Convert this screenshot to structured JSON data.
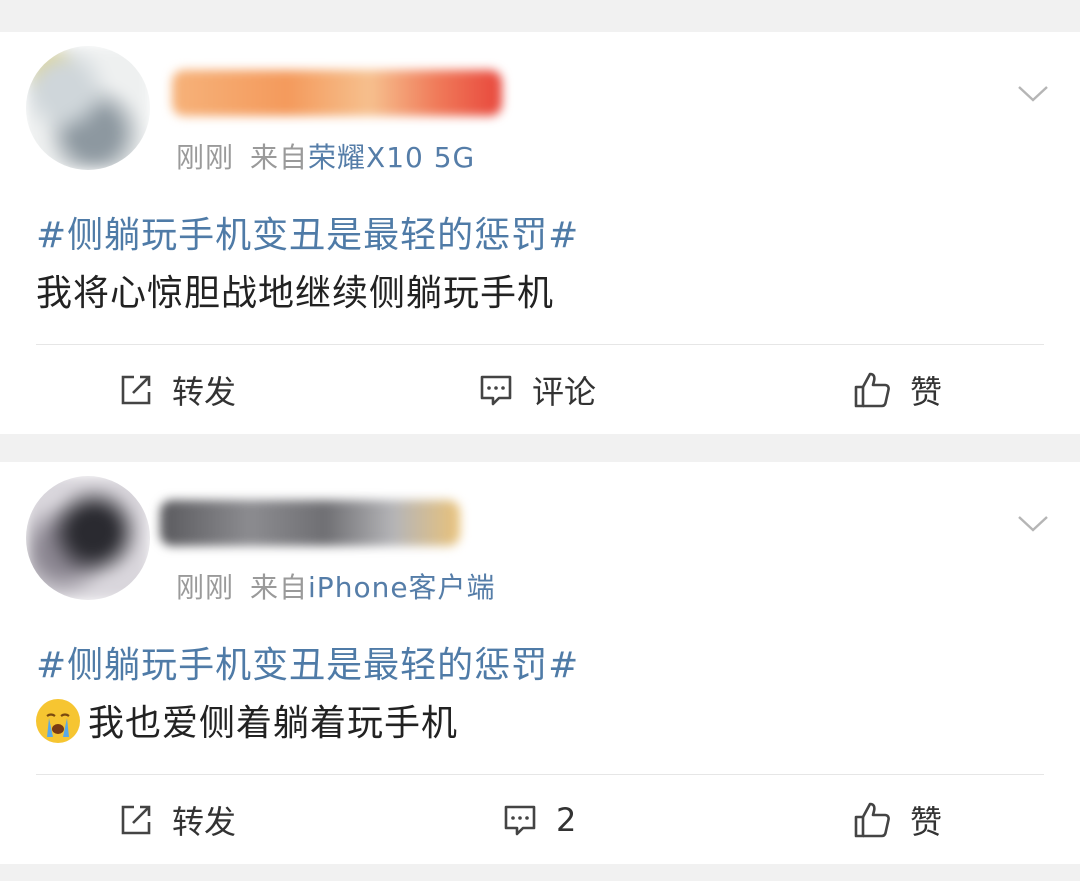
{
  "colors": {
    "link": "#4f7ba7",
    "meta": "#9a9a9a",
    "text": "#222222",
    "background": "#f1f1f1"
  },
  "posts": [
    {
      "time": "刚刚",
      "source_prefix": "来自",
      "source": "荣耀X10 5G",
      "hashtag": "#侧躺玩手机变丑是最轻的惩罚#",
      "text": "我将心惊胆战地继续侧躺玩手机",
      "emoji": "",
      "actions": {
        "repost": "转发",
        "comment": "评论",
        "like": "赞"
      }
    },
    {
      "time": "刚刚",
      "source_prefix": "来自",
      "source": "iPhone客户端",
      "hashtag": "#侧躺玩手机变丑是最轻的惩罚#",
      "text": "我也爱侧着躺着玩手机",
      "emoji": "crying-face-emoji",
      "actions": {
        "repost": "转发",
        "comment": "2",
        "like": "赞"
      }
    }
  ]
}
